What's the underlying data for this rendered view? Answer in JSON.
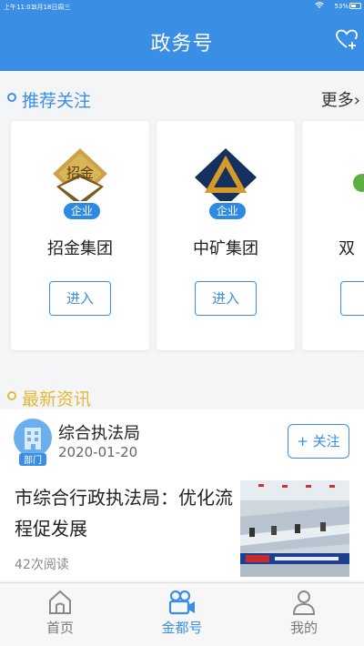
{
  "status_bar": {
    "time": "上午11:01",
    "date": "3月18日周三",
    "battery": "53%",
    "battery_level": 0.53
  },
  "header": {
    "title": "政务号",
    "action_icon": "heart-plus-icon"
  },
  "recommended": {
    "title": "推荐关注",
    "more_label": "更多",
    "accent_color": "#3a8ee6",
    "title_color": "#3a8ee6",
    "cards": [
      {
        "name": "招金集团",
        "badge": "企业",
        "logo_text": "招金",
        "button": "进入"
      },
      {
        "name": "中矿集团",
        "badge": "企业",
        "button": "进入"
      },
      {
        "name": "双",
        "button": "进"
      }
    ]
  },
  "latest_news": {
    "title": "最新资讯",
    "title_color": "#e8b73a",
    "source": {
      "name": "综合执法局",
      "badge": "部门",
      "date": "2020-01-20",
      "follow_label": "+ 关注"
    },
    "article": {
      "title": "市综合行政执法局：优化流程促发展",
      "reads": "42次阅读"
    }
  },
  "tab_bar": {
    "active_color": "#3a8ee6",
    "tabs": [
      {
        "label": "首页",
        "icon": "home-icon"
      },
      {
        "label": "金都号",
        "icon": "camera-icon"
      },
      {
        "label": "我的",
        "icon": "person-icon"
      }
    ]
  }
}
